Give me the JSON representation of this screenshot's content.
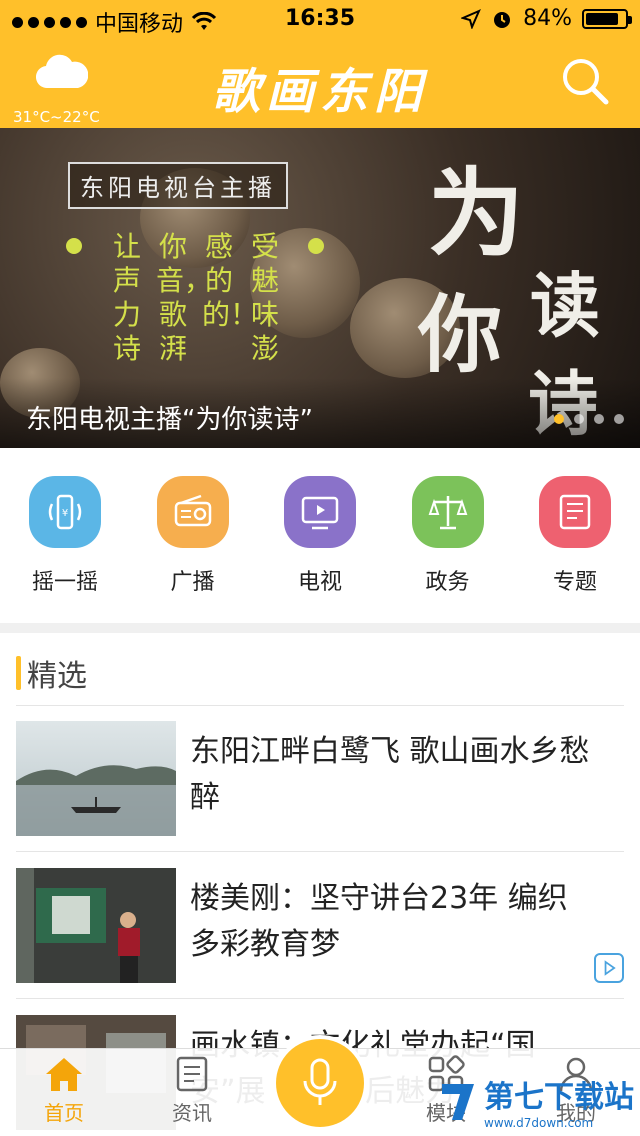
{
  "status_bar": {
    "carrier": "中国移动",
    "time": "16:35",
    "battery": "84%",
    "battery_level": 0.84
  },
  "header": {
    "temperature": "31°C~22°C",
    "brand": "歌画东阳",
    "weather_icon": "cloud-icon",
    "search_icon": "search-icon"
  },
  "banner": {
    "tag": "东阳电视台主播",
    "big_1": "为",
    "big_2": "你",
    "big_3": "读",
    "big_4": "诗",
    "columns": [
      "让声力诗",
      "你音，歌湃",
      "感的的！",
      "受魅味澎"
    ],
    "caption": "东阳电视主播“为你读诗”",
    "pages": 4,
    "active_page": 1
  },
  "quick_nav": [
    {
      "label": "摇一摇",
      "icon": "shake-phone-icon",
      "color": "#5BB6E6"
    },
    {
      "label": "广播",
      "icon": "radio-icon",
      "color": "#F6AE4E"
    },
    {
      "label": "电视",
      "icon": "tv-icon",
      "color": "#8A72C9"
    },
    {
      "label": "政务",
      "icon": "scales-icon",
      "color": "#7CC25A"
    },
    {
      "label": "专题",
      "icon": "document-icon",
      "color": "#EE6170"
    }
  ],
  "featured": {
    "section_title": "精选",
    "articles": [
      {
        "title": "东阳江畔白鹭飞 歌山画水乡愁醉",
        "has_video": false
      },
      {
        "title": "楼美刚：坚守讲台23年 编织多彩教育梦",
        "has_video": true
      },
      {
        "title": "画水镇：文化礼堂办起“国安”展 元素幕后魅力",
        "has_video": false
      }
    ]
  },
  "tabbar": {
    "tabs": [
      {
        "label": "首页",
        "icon": "home-icon",
        "active": true
      },
      {
        "label": "资讯",
        "icon": "news-icon",
        "active": false
      },
      {
        "label": "模块",
        "icon": "grid-icon",
        "active": false
      },
      {
        "label": "我的",
        "icon": "user-icon",
        "active": false
      }
    ],
    "mic_icon": "microphone-icon"
  },
  "watermark": {
    "main": "第七下载站",
    "sub": "www.d7down.com"
  },
  "colors": {
    "accent": "#FFC02A",
    "active_tab": "#F4A50A"
  }
}
